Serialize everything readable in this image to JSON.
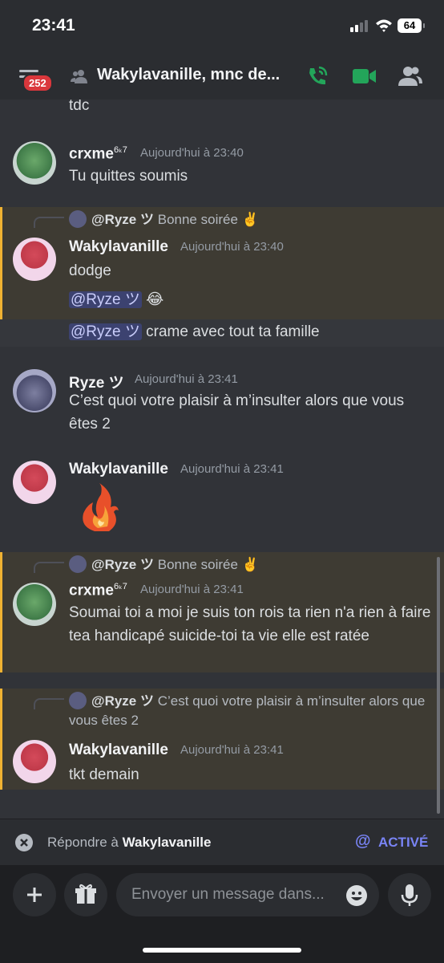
{
  "status": {
    "time": "23:41",
    "battery": "64"
  },
  "header": {
    "badge": "252",
    "title": "Wakylavanille, mnc de..."
  },
  "messages": {
    "m0": {
      "text": "tdc"
    },
    "m1": {
      "author": "crxme",
      "sup": "6ₖ7",
      "time": "Aujourd'hui à 23:40",
      "text": "Tu quittes soumis"
    },
    "m2": {
      "reply_author": "@Ryze ツ",
      "reply_text": "Bonne soirée ✌️",
      "author": "Wakylavanille",
      "time": "Aujourd'hui à 23:40",
      "text": "dodge",
      "mention1": "@Ryze ツ",
      "mention1_emoji": "😂",
      "mention2": "@Ryze ツ",
      "line3": "crame avec tout ta famille"
    },
    "m3": {
      "author": "Ryze ツ",
      "time": "Aujourd'hui à 23:41",
      "text": "C’est quoi votre plaisir à m’insulter alors que vous êtes 2"
    },
    "m4": {
      "author": "Wakylavanille",
      "time": "Aujourd'hui à 23:41"
    },
    "m5": {
      "reply_author": "@Ryze ツ",
      "reply_text": "Bonne soirée ✌️",
      "author": "crxme",
      "sup": "6ₖ7",
      "time": "Aujourd'hui à 23:41",
      "text": "Soumai toi a moi je suis ton rois ta rien n'a rien à faire tea  handicapé suicide-toi ta vie elle est ratée"
    },
    "m6": {
      "reply_author": "@Ryze ツ",
      "reply_text": "C’est quoi votre plaisir à m’insulter alors que vous êtes 2",
      "author": "Wakylavanille",
      "time": "Aujourd'hui à 23:41",
      "text": "tkt demain"
    }
  },
  "replybar": {
    "prefix": "Répondre à ",
    "name": "Wakylavanille",
    "at": "@",
    "active": "ACTIVÉ"
  },
  "composer": {
    "placeholder": "Envoyer un message dans..."
  },
  "colors": {
    "mention_bg": "#3e3b33",
    "mention_bar": "#f0b232",
    "accent": "#7984f5",
    "call_green": "#23a55a",
    "badge_red": "#da373c"
  }
}
